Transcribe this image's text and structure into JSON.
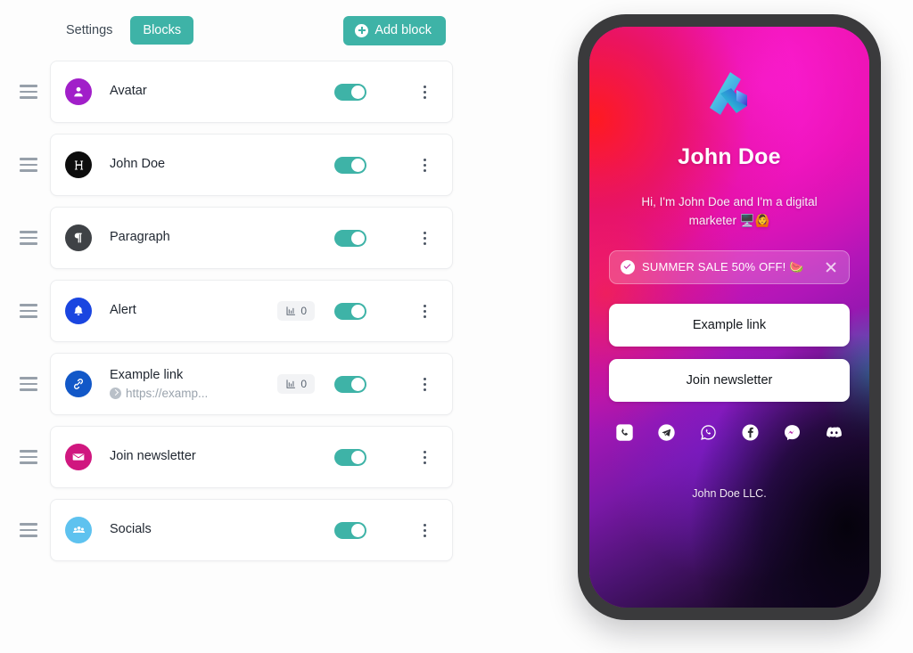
{
  "toolbar": {
    "tabs": [
      {
        "label": "Settings",
        "active": false
      },
      {
        "label": "Blocks",
        "active": true
      }
    ],
    "add_block_label": "Add block",
    "accent_color": "#3eb3a7"
  },
  "blocks": [
    {
      "title": "Avatar",
      "subtitle": "",
      "icon": "user-icon",
      "icon_color": "#a11fc9",
      "stats": null,
      "enabled": true
    },
    {
      "title": "John Doe",
      "subtitle": "",
      "icon": "heading-icon",
      "icon_color": "#0d0d0d",
      "stats": null,
      "enabled": true
    },
    {
      "title": "Paragraph",
      "subtitle": "",
      "icon": "paragraph-icon",
      "icon_color": "#3f4246",
      "stats": null,
      "enabled": true
    },
    {
      "title": "Alert",
      "subtitle": "",
      "icon": "bell-icon",
      "icon_color": "#1a45e0",
      "stats": "0",
      "enabled": true
    },
    {
      "title": "Example link",
      "subtitle": "https://examp...",
      "icon": "link-icon",
      "icon_color": "#1258c8",
      "stats": "0",
      "enabled": true
    },
    {
      "title": "Join newsletter",
      "subtitle": "",
      "icon": "envelope-icon",
      "icon_color": "#d0177f",
      "stats": null,
      "enabled": true
    },
    {
      "title": "Socials",
      "subtitle": "",
      "icon": "people-icon",
      "icon_color": "#5ec2ef",
      "stats": null,
      "enabled": true
    }
  ],
  "preview": {
    "profile_name": "John Doe",
    "bio": "Hi, I'm John Doe and I'm a digital marketer 🖥️🙆",
    "alert": {
      "text": "SUMMER SALE 50% OFF! 🍉",
      "icon": "check-circle-icon",
      "close_icon": "close-icon"
    },
    "links": [
      {
        "label": "Example link"
      },
      {
        "label": "Join newsletter"
      }
    ],
    "socials": [
      {
        "name": "phone-icon"
      },
      {
        "name": "telegram-icon"
      },
      {
        "name": "whatsapp-icon"
      },
      {
        "name": "facebook-icon"
      },
      {
        "name": "messenger-icon"
      },
      {
        "name": "discord-icon"
      }
    ],
    "footer": "John Doe LLC."
  }
}
